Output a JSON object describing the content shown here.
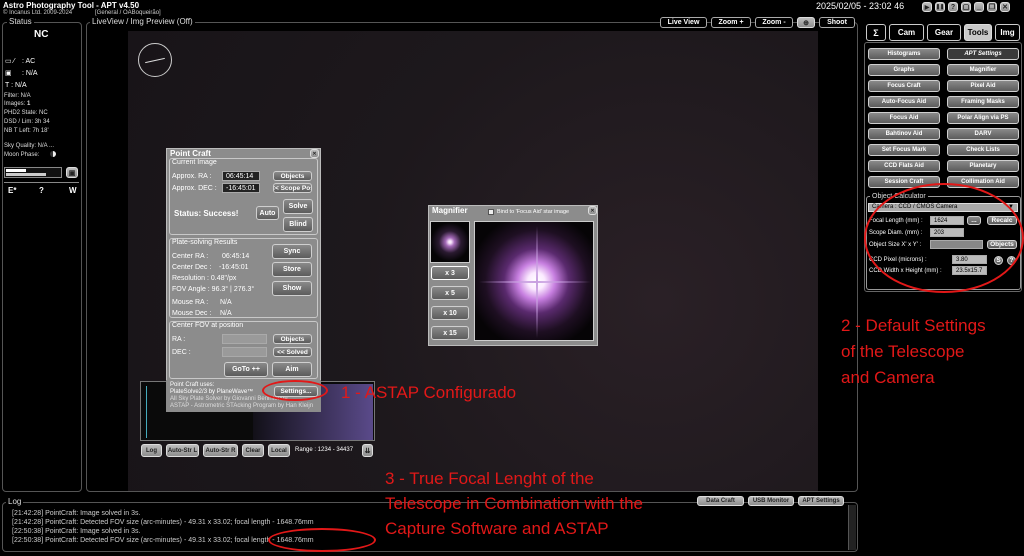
{
  "app": {
    "title": "Astro Photography Tool  -  APT v4.50",
    "copyright": "© Incanus Ltd. 2009-2024",
    "profile": "[General / OABoqueirão]",
    "datetime": "2025/02/05  -  23:02 46"
  },
  "status": {
    "title": "Status",
    "state": "NC",
    "power": ": AC",
    "camera": ": N/A",
    "temp": "T : N/A",
    "filter": "Filter: N/A",
    "images": "Images: ",
    "images_count": "1",
    "phd2": "PHD2 State: NC",
    "dsd": "DSD / Lim: 3h 34",
    "nb": "NB T Left: 7h 18'",
    "sky": "Sky Quality: N/A ...",
    "moon": "Moon Phase:",
    "e": "E*",
    "q": "?",
    "w": "W"
  },
  "liveview": {
    "title": "LiveView / Img Preview (Off)",
    "buttons": {
      "live": "Live View",
      "zoom_in": "Zoom +",
      "zoom_out": "Zoom -",
      "shoot": "Shoot"
    }
  },
  "pointcraft": {
    "title": "Point Craft",
    "current": "Current Image",
    "ra_label": "Approx. RA :",
    "ra": "06:45:14",
    "dec_label": "Approx. DEC :",
    "dec": "-16:45:01",
    "objects": "Objects",
    "scope_pos": "<< Scope Pos",
    "status": "Status: Success!",
    "auto": "Auto",
    "solve": "Solve",
    "blind": "Blind",
    "results": "Plate-solving Results",
    "c_ra_label": "Center RA :",
    "c_ra": "06:45:14",
    "c_dec_label": "Center Dec :",
    "c_dec": "-16:45:01",
    "resolution": "Resolution : 0.48\"/px",
    "fov": "FOV Angle : 96.3° | 276.3°",
    "m_ra_label": "Mouse RA :",
    "m_ra": "N/A",
    "m_dec_label": "Mouse Dec :",
    "m_dec": "N/A",
    "sync": "Sync",
    "store": "Store",
    "show": "Show",
    "center": "Center FOV at position",
    "ra2": "RA :",
    "dec2": "DEC :",
    "objects2": "Objects",
    "solved": "<< Solved",
    "goto": "GoTo ++",
    "aim": "Aim",
    "uses1": "Point Craft uses:",
    "uses2": "PlateSolve2/3 by PlaneWave™",
    "uses3": "All Sky Plate Solver by Giovanni Benintende",
    "uses4": "ASTAP - Astrometric STAcking Program by Han Kleijn",
    "settings": "Settings..."
  },
  "bottombar": {
    "log": "Log",
    "auto_l": "Auto-Str L",
    "auto_r": "Auto-Str R",
    "clear": "Clear",
    "local": "Local",
    "range": "Range : 1234 - 34437"
  },
  "magnifier": {
    "title": "Magnifier",
    "bind": "Bind to 'Focus Aid' star image",
    "zooms": [
      "x 3",
      "x 5",
      "x 10",
      "x 15"
    ]
  },
  "tabs": [
    "Σ",
    "Cam",
    "Gear",
    "Tools",
    "Img"
  ],
  "tools": [
    [
      "Histograms",
      "APT Settings"
    ],
    [
      "Graphs",
      "Magnifier"
    ],
    [
      "Focus Craft",
      "Pixel Aid"
    ],
    [
      "Auto-Focus Aid",
      "Framing Masks"
    ],
    [
      "Focus Aid",
      "Polar Align via PS"
    ],
    [
      "Bahtinov Aid",
      "DARV"
    ],
    [
      "Set Focus Mark",
      "Check Lists"
    ],
    [
      "CCD Flats Aid",
      "Planetary"
    ],
    [
      "Session Craft",
      "Collimation Aid"
    ]
  ],
  "calc": {
    "title": "Object Calculator",
    "camera": "Camera : CCD / CMOS Camera",
    "focal_label": "Focal Length (mm) :",
    "focal": "1624",
    "dots": "...",
    "recalc": "Recalc",
    "diam_label": "Scope Diam. (mm) :",
    "diam": "203",
    "size_label": "Object Size X' x Y' :",
    "objects": "Objects",
    "pixel_label": "CCD Pixel (microns) :",
    "pixel": "3.80",
    "s": "S",
    "q": "?",
    "wh_label": "CCD Width x Height (mm) :",
    "wh": "23.5x15.7"
  },
  "log": {
    "title": "Log",
    "lines": [
      "[21:42:28] PointCraft: Image solved in 3s.",
      "[21:42:28] PointCraft: Detected FOV size (arc-minutes) - 49.31 x 33.02; focal length - 1648.76mm",
      "[22:50:38] PointCraft: Image solved in 3s.",
      "[22:50:38] PointCraft: Detected FOV size (arc-minutes) - 49.31 x 33.02; focal length - 1648.76mm"
    ],
    "buttons": [
      "Data Craft",
      "USB Monitor",
      "APT Settings"
    ]
  },
  "annotations": {
    "a1": "1 - ASTAP Configurado",
    "a2_1": "2 - Default Settings",
    "a2_2": "of the Telescope",
    "a2_3": "and Camera",
    "a3_1": "3 - True Focal Lenght of the",
    "a3_2": "Telescope in Combination with the",
    "a3_3": "Capture Software and ASTAP"
  },
  "colors": {
    "annotation": "#e21818",
    "tab_active": "#c8c8c8",
    "panel_bg": "#8c8c8c"
  }
}
